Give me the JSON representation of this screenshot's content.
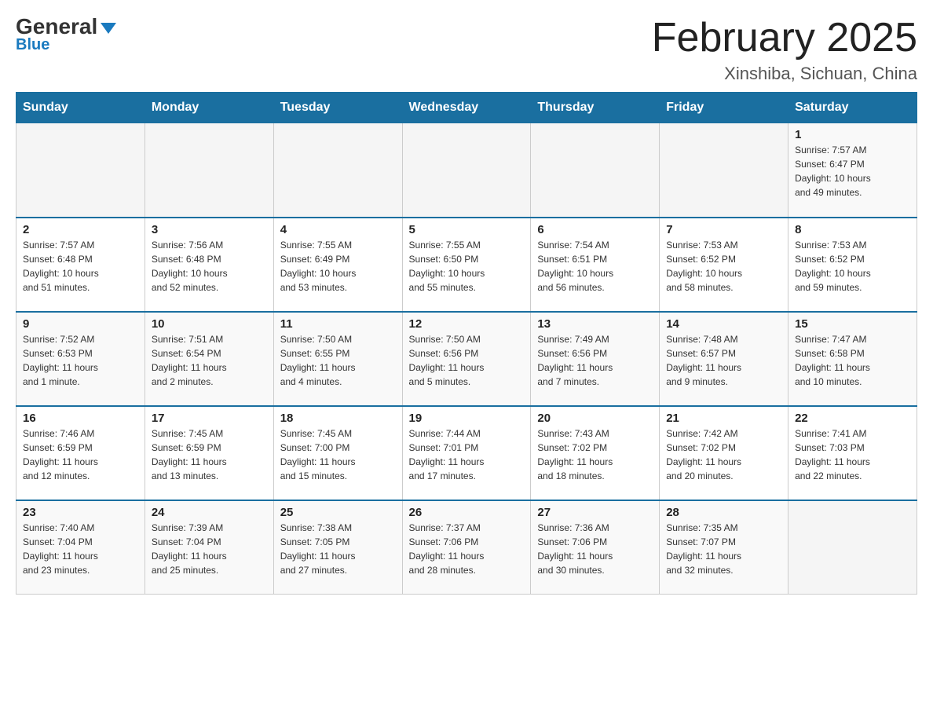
{
  "header": {
    "logo_general": "General",
    "logo_blue": "Blue",
    "month_title": "February 2025",
    "location": "Xinshiba, Sichuan, China"
  },
  "days_of_week": [
    "Sunday",
    "Monday",
    "Tuesday",
    "Wednesday",
    "Thursday",
    "Friday",
    "Saturday"
  ],
  "weeks": [
    [
      {
        "day": "",
        "info": ""
      },
      {
        "day": "",
        "info": ""
      },
      {
        "day": "",
        "info": ""
      },
      {
        "day": "",
        "info": ""
      },
      {
        "day": "",
        "info": ""
      },
      {
        "day": "",
        "info": ""
      },
      {
        "day": "1",
        "info": "Sunrise: 7:57 AM\nSunset: 6:47 PM\nDaylight: 10 hours\nand 49 minutes."
      }
    ],
    [
      {
        "day": "2",
        "info": "Sunrise: 7:57 AM\nSunset: 6:48 PM\nDaylight: 10 hours\nand 51 minutes."
      },
      {
        "day": "3",
        "info": "Sunrise: 7:56 AM\nSunset: 6:48 PM\nDaylight: 10 hours\nand 52 minutes."
      },
      {
        "day": "4",
        "info": "Sunrise: 7:55 AM\nSunset: 6:49 PM\nDaylight: 10 hours\nand 53 minutes."
      },
      {
        "day": "5",
        "info": "Sunrise: 7:55 AM\nSunset: 6:50 PM\nDaylight: 10 hours\nand 55 minutes."
      },
      {
        "day": "6",
        "info": "Sunrise: 7:54 AM\nSunset: 6:51 PM\nDaylight: 10 hours\nand 56 minutes."
      },
      {
        "day": "7",
        "info": "Sunrise: 7:53 AM\nSunset: 6:52 PM\nDaylight: 10 hours\nand 58 minutes."
      },
      {
        "day": "8",
        "info": "Sunrise: 7:53 AM\nSunset: 6:52 PM\nDaylight: 10 hours\nand 59 minutes."
      }
    ],
    [
      {
        "day": "9",
        "info": "Sunrise: 7:52 AM\nSunset: 6:53 PM\nDaylight: 11 hours\nand 1 minute."
      },
      {
        "day": "10",
        "info": "Sunrise: 7:51 AM\nSunset: 6:54 PM\nDaylight: 11 hours\nand 2 minutes."
      },
      {
        "day": "11",
        "info": "Sunrise: 7:50 AM\nSunset: 6:55 PM\nDaylight: 11 hours\nand 4 minutes."
      },
      {
        "day": "12",
        "info": "Sunrise: 7:50 AM\nSunset: 6:56 PM\nDaylight: 11 hours\nand 5 minutes."
      },
      {
        "day": "13",
        "info": "Sunrise: 7:49 AM\nSunset: 6:56 PM\nDaylight: 11 hours\nand 7 minutes."
      },
      {
        "day": "14",
        "info": "Sunrise: 7:48 AM\nSunset: 6:57 PM\nDaylight: 11 hours\nand 9 minutes."
      },
      {
        "day": "15",
        "info": "Sunrise: 7:47 AM\nSunset: 6:58 PM\nDaylight: 11 hours\nand 10 minutes."
      }
    ],
    [
      {
        "day": "16",
        "info": "Sunrise: 7:46 AM\nSunset: 6:59 PM\nDaylight: 11 hours\nand 12 minutes."
      },
      {
        "day": "17",
        "info": "Sunrise: 7:45 AM\nSunset: 6:59 PM\nDaylight: 11 hours\nand 13 minutes."
      },
      {
        "day": "18",
        "info": "Sunrise: 7:45 AM\nSunset: 7:00 PM\nDaylight: 11 hours\nand 15 minutes."
      },
      {
        "day": "19",
        "info": "Sunrise: 7:44 AM\nSunset: 7:01 PM\nDaylight: 11 hours\nand 17 minutes."
      },
      {
        "day": "20",
        "info": "Sunrise: 7:43 AM\nSunset: 7:02 PM\nDaylight: 11 hours\nand 18 minutes."
      },
      {
        "day": "21",
        "info": "Sunrise: 7:42 AM\nSunset: 7:02 PM\nDaylight: 11 hours\nand 20 minutes."
      },
      {
        "day": "22",
        "info": "Sunrise: 7:41 AM\nSunset: 7:03 PM\nDaylight: 11 hours\nand 22 minutes."
      }
    ],
    [
      {
        "day": "23",
        "info": "Sunrise: 7:40 AM\nSunset: 7:04 PM\nDaylight: 11 hours\nand 23 minutes."
      },
      {
        "day": "24",
        "info": "Sunrise: 7:39 AM\nSunset: 7:04 PM\nDaylight: 11 hours\nand 25 minutes."
      },
      {
        "day": "25",
        "info": "Sunrise: 7:38 AM\nSunset: 7:05 PM\nDaylight: 11 hours\nand 27 minutes."
      },
      {
        "day": "26",
        "info": "Sunrise: 7:37 AM\nSunset: 7:06 PM\nDaylight: 11 hours\nand 28 minutes."
      },
      {
        "day": "27",
        "info": "Sunrise: 7:36 AM\nSunset: 7:06 PM\nDaylight: 11 hours\nand 30 minutes."
      },
      {
        "day": "28",
        "info": "Sunrise: 7:35 AM\nSunset: 7:07 PM\nDaylight: 11 hours\nand 32 minutes."
      },
      {
        "day": "",
        "info": ""
      }
    ]
  ]
}
